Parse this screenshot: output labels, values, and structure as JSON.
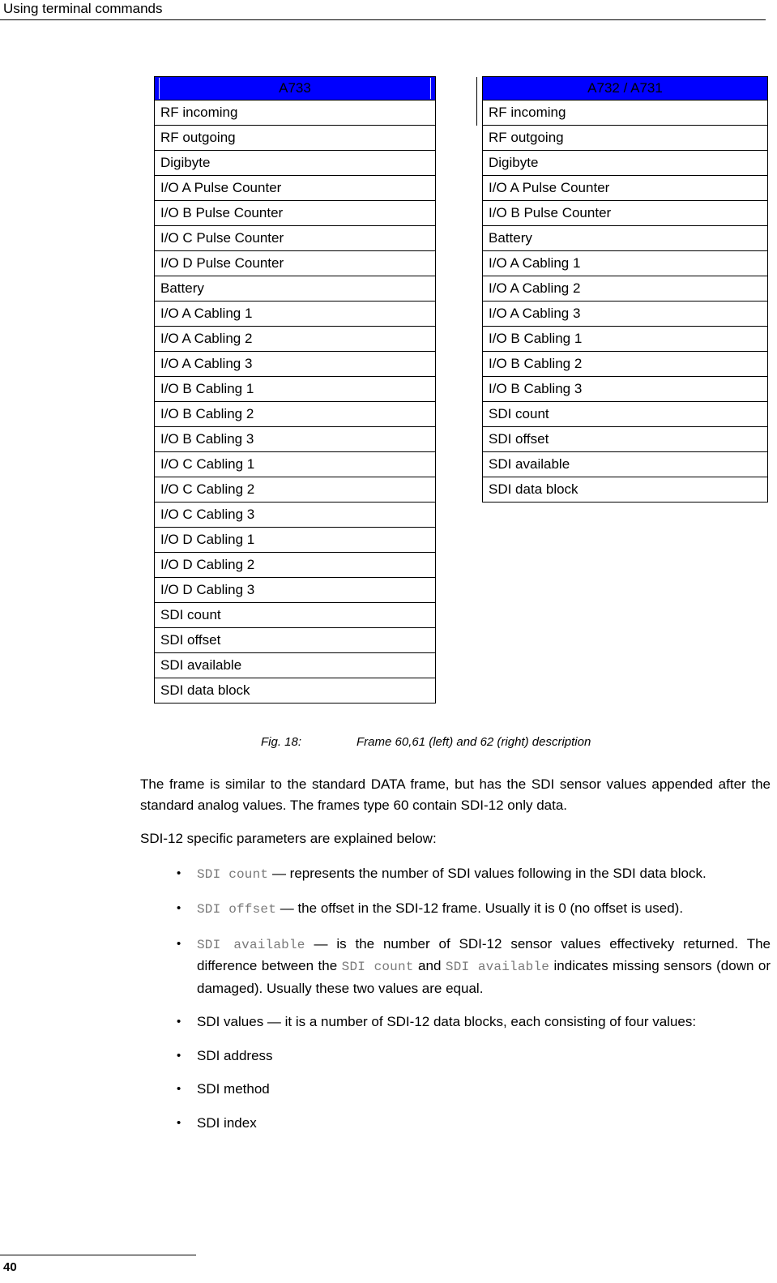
{
  "header": {
    "title": "Using terminal commands"
  },
  "figure": {
    "tables": [
      {
        "id": "a733",
        "header": "A733",
        "rows": [
          "RF incoming",
          "RF outgoing",
          "Digibyte",
          "I/O A Pulse Counter",
          "I/O B Pulse Counter",
          "I/O C Pulse Counter",
          "I/O D Pulse Counter",
          "Battery",
          "I/O A Cabling 1",
          "I/O A Cabling 2",
          "I/O A Cabling 3",
          "I/O B Cabling 1",
          "I/O B Cabling 2",
          "I/O B Cabling 3",
          "I/O C Cabling 1",
          "I/O C Cabling 2",
          "I/O C Cabling 3",
          "I/O D Cabling 1",
          "I/O D Cabling 2",
          "I/O D Cabling 3",
          "SDI count",
          "SDI offset",
          "SDI available",
          "SDI data block"
        ]
      },
      {
        "id": "a732-a731",
        "header": "A732 / A731",
        "rows": [
          "RF incoming",
          "RF outgoing",
          "Digibyte",
          "I/O A Pulse Counter",
          "I/O B Pulse Counter",
          "Battery",
          "I/O A Cabling 1",
          "I/O A Cabling 2",
          "I/O A Cabling 3",
          "I/O B Cabling 1",
          "I/O B Cabling 2",
          "I/O B Cabling 3",
          "SDI count",
          "SDI offset",
          "SDI available",
          "SDI data block"
        ]
      }
    ],
    "caption_label": "Fig. 18:",
    "caption_text": "Frame 60,61 (left) and 62 (right) description",
    "header_fill_color": "#0000ff"
  },
  "body": {
    "paragraph_1": "The frame is similar to the standard DATA frame, but has the SDI sensor values appended after the standard analog values. The frames type 60 contain SDI-12 only data.",
    "paragraph_2": "SDI-12 specific parameters are explained below:",
    "bullets": [
      {
        "code_1": "SDI count",
        "text_1": " — represents the number of SDI values following in the SDI data block."
      },
      {
        "code_1": "SDI offset",
        "text_1": " — the offset in the SDI-12 frame. Usually it is 0 (no offset is used)."
      },
      {
        "code_1": "SDI available",
        "text_1": " — is the number of SDI-12 sensor values effectiveky returned. The difference between the ",
        "code_2": "SDI count",
        "text_2": " and ",
        "code_3": "SDI available",
        "text_3": " indicates missing sensors (down or damaged). Usually these two values are equal."
      },
      {
        "text_1": "SDI values — it is a number of SDI-12 data blocks, each consisting of four values:"
      },
      {
        "text_1": "SDI address"
      },
      {
        "text_1": "SDI method"
      },
      {
        "text_1": "SDI index"
      }
    ]
  },
  "footer": {
    "page_number": "40"
  }
}
